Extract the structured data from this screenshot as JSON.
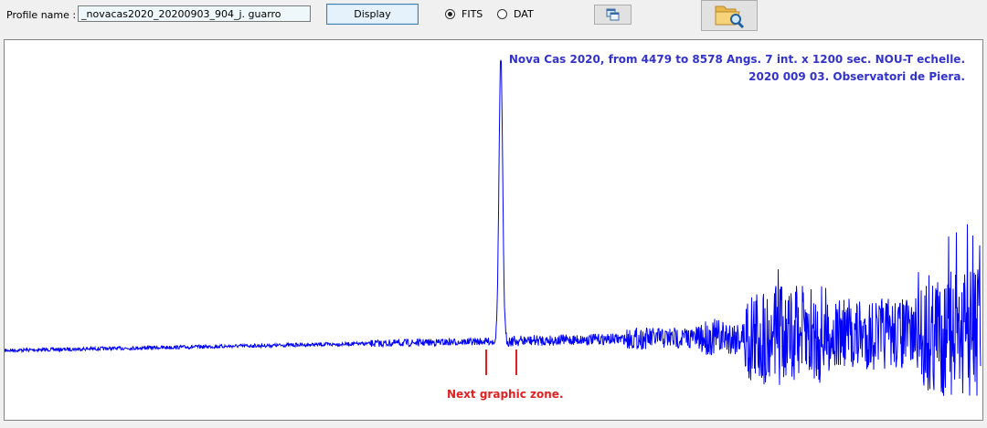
{
  "toolbar": {
    "profile_label": "Profile name :",
    "profile_value": "_novacas2020_20200903_904_j. guarro",
    "display_label": "Display",
    "format_options": [
      {
        "label": "FITS",
        "selected": true
      },
      {
        "label": "DAT",
        "selected": false
      }
    ],
    "copy_icon": "copy-windows-icon",
    "open_icon": "folder-search-icon"
  },
  "plot": {
    "title_line1": "Nova Cas 2020, from 4479 to 8578 Angs.  7 int. x 1200 sec. NOU-T echelle.",
    "title_line2": "2020 009 03. Observatori de Piera.",
    "zone_label": "Next graphic zone.",
    "line_color": "#0000ff",
    "label_color": "#3333cc",
    "marker_color": "#e02020"
  }
}
